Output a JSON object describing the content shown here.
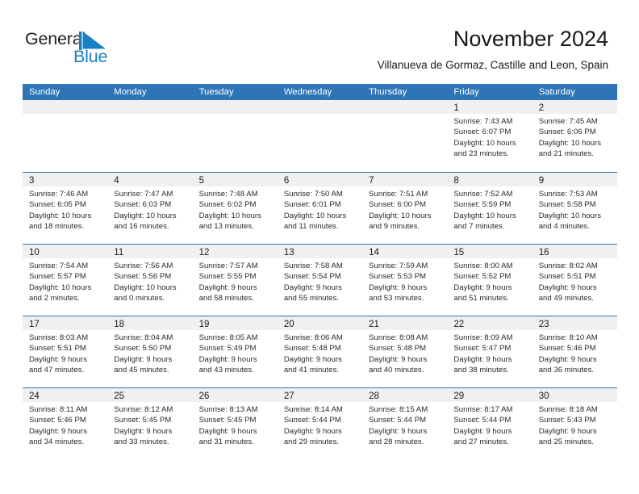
{
  "brand": {
    "name_part1": "General",
    "name_part2": "Blue",
    "logo_icon": "blue-flag-triangle-icon",
    "color_primary": "#1b7fc4",
    "color_dark": "#231f20"
  },
  "header": {
    "title": "November 2024",
    "subtitle": "Villanueva de Gormaz, Castille and Leon, Spain"
  },
  "theme": {
    "header_row_bg": "#2e75b6",
    "day_band_bg": "#f0f0f0",
    "cell_bg": "#ffffff",
    "text_color": "#2b2b2b"
  },
  "weekdays": [
    "Sunday",
    "Monday",
    "Tuesday",
    "Wednesday",
    "Thursday",
    "Friday",
    "Saturday"
  ],
  "weeks": [
    [
      {
        "day": "",
        "empty": true
      },
      {
        "day": "",
        "empty": true
      },
      {
        "day": "",
        "empty": true
      },
      {
        "day": "",
        "empty": true
      },
      {
        "day": "",
        "empty": true
      },
      {
        "day": "1",
        "sunrise": "Sunrise: 7:43 AM",
        "sunset": "Sunset: 6:07 PM",
        "daylight_1": "Daylight: 10 hours",
        "daylight_2": "and 23 minutes."
      },
      {
        "day": "2",
        "sunrise": "Sunrise: 7:45 AM",
        "sunset": "Sunset: 6:06 PM",
        "daylight_1": "Daylight: 10 hours",
        "daylight_2": "and 21 minutes."
      }
    ],
    [
      {
        "day": "3",
        "sunrise": "Sunrise: 7:46 AM",
        "sunset": "Sunset: 6:05 PM",
        "daylight_1": "Daylight: 10 hours",
        "daylight_2": "and 18 minutes."
      },
      {
        "day": "4",
        "sunrise": "Sunrise: 7:47 AM",
        "sunset": "Sunset: 6:03 PM",
        "daylight_1": "Daylight: 10 hours",
        "daylight_2": "and 16 minutes."
      },
      {
        "day": "5",
        "sunrise": "Sunrise: 7:48 AM",
        "sunset": "Sunset: 6:02 PM",
        "daylight_1": "Daylight: 10 hours",
        "daylight_2": "and 13 minutes."
      },
      {
        "day": "6",
        "sunrise": "Sunrise: 7:50 AM",
        "sunset": "Sunset: 6:01 PM",
        "daylight_1": "Daylight: 10 hours",
        "daylight_2": "and 11 minutes."
      },
      {
        "day": "7",
        "sunrise": "Sunrise: 7:51 AM",
        "sunset": "Sunset: 6:00 PM",
        "daylight_1": "Daylight: 10 hours",
        "daylight_2": "and 9 minutes."
      },
      {
        "day": "8",
        "sunrise": "Sunrise: 7:52 AM",
        "sunset": "Sunset: 5:59 PM",
        "daylight_1": "Daylight: 10 hours",
        "daylight_2": "and 7 minutes."
      },
      {
        "day": "9",
        "sunrise": "Sunrise: 7:53 AM",
        "sunset": "Sunset: 5:58 PM",
        "daylight_1": "Daylight: 10 hours",
        "daylight_2": "and 4 minutes."
      }
    ],
    [
      {
        "day": "10",
        "sunrise": "Sunrise: 7:54 AM",
        "sunset": "Sunset: 5:57 PM",
        "daylight_1": "Daylight: 10 hours",
        "daylight_2": "and 2 minutes."
      },
      {
        "day": "11",
        "sunrise": "Sunrise: 7:56 AM",
        "sunset": "Sunset: 5:56 PM",
        "daylight_1": "Daylight: 10 hours",
        "daylight_2": "and 0 minutes."
      },
      {
        "day": "12",
        "sunrise": "Sunrise: 7:57 AM",
        "sunset": "Sunset: 5:55 PM",
        "daylight_1": "Daylight: 9 hours",
        "daylight_2": "and 58 minutes."
      },
      {
        "day": "13",
        "sunrise": "Sunrise: 7:58 AM",
        "sunset": "Sunset: 5:54 PM",
        "daylight_1": "Daylight: 9 hours",
        "daylight_2": "and 55 minutes."
      },
      {
        "day": "14",
        "sunrise": "Sunrise: 7:59 AM",
        "sunset": "Sunset: 5:53 PM",
        "daylight_1": "Daylight: 9 hours",
        "daylight_2": "and 53 minutes."
      },
      {
        "day": "15",
        "sunrise": "Sunrise: 8:00 AM",
        "sunset": "Sunset: 5:52 PM",
        "daylight_1": "Daylight: 9 hours",
        "daylight_2": "and 51 minutes."
      },
      {
        "day": "16",
        "sunrise": "Sunrise: 8:02 AM",
        "sunset": "Sunset: 5:51 PM",
        "daylight_1": "Daylight: 9 hours",
        "daylight_2": "and 49 minutes."
      }
    ],
    [
      {
        "day": "17",
        "sunrise": "Sunrise: 8:03 AM",
        "sunset": "Sunset: 5:51 PM",
        "daylight_1": "Daylight: 9 hours",
        "daylight_2": "and 47 minutes."
      },
      {
        "day": "18",
        "sunrise": "Sunrise: 8:04 AM",
        "sunset": "Sunset: 5:50 PM",
        "daylight_1": "Daylight: 9 hours",
        "daylight_2": "and 45 minutes."
      },
      {
        "day": "19",
        "sunrise": "Sunrise: 8:05 AM",
        "sunset": "Sunset: 5:49 PM",
        "daylight_1": "Daylight: 9 hours",
        "daylight_2": "and 43 minutes."
      },
      {
        "day": "20",
        "sunrise": "Sunrise: 8:06 AM",
        "sunset": "Sunset: 5:48 PM",
        "daylight_1": "Daylight: 9 hours",
        "daylight_2": "and 41 minutes."
      },
      {
        "day": "21",
        "sunrise": "Sunrise: 8:08 AM",
        "sunset": "Sunset: 5:48 PM",
        "daylight_1": "Daylight: 9 hours",
        "daylight_2": "and 40 minutes."
      },
      {
        "day": "22",
        "sunrise": "Sunrise: 8:09 AM",
        "sunset": "Sunset: 5:47 PM",
        "daylight_1": "Daylight: 9 hours",
        "daylight_2": "and 38 minutes."
      },
      {
        "day": "23",
        "sunrise": "Sunrise: 8:10 AM",
        "sunset": "Sunset: 5:46 PM",
        "daylight_1": "Daylight: 9 hours",
        "daylight_2": "and 36 minutes."
      }
    ],
    [
      {
        "day": "24",
        "sunrise": "Sunrise: 8:11 AM",
        "sunset": "Sunset: 5:46 PM",
        "daylight_1": "Daylight: 9 hours",
        "daylight_2": "and 34 minutes."
      },
      {
        "day": "25",
        "sunrise": "Sunrise: 8:12 AM",
        "sunset": "Sunset: 5:45 PM",
        "daylight_1": "Daylight: 9 hours",
        "daylight_2": "and 33 minutes."
      },
      {
        "day": "26",
        "sunrise": "Sunrise: 8:13 AM",
        "sunset": "Sunset: 5:45 PM",
        "daylight_1": "Daylight: 9 hours",
        "daylight_2": "and 31 minutes."
      },
      {
        "day": "27",
        "sunrise": "Sunrise: 8:14 AM",
        "sunset": "Sunset: 5:44 PM",
        "daylight_1": "Daylight: 9 hours",
        "daylight_2": "and 29 minutes."
      },
      {
        "day": "28",
        "sunrise": "Sunrise: 8:15 AM",
        "sunset": "Sunset: 5:44 PM",
        "daylight_1": "Daylight: 9 hours",
        "daylight_2": "and 28 minutes."
      },
      {
        "day": "29",
        "sunrise": "Sunrise: 8:17 AM",
        "sunset": "Sunset: 5:44 PM",
        "daylight_1": "Daylight: 9 hours",
        "daylight_2": "and 27 minutes."
      },
      {
        "day": "30",
        "sunrise": "Sunrise: 8:18 AM",
        "sunset": "Sunset: 5:43 PM",
        "daylight_1": "Daylight: 9 hours",
        "daylight_2": "and 25 minutes."
      }
    ]
  ]
}
